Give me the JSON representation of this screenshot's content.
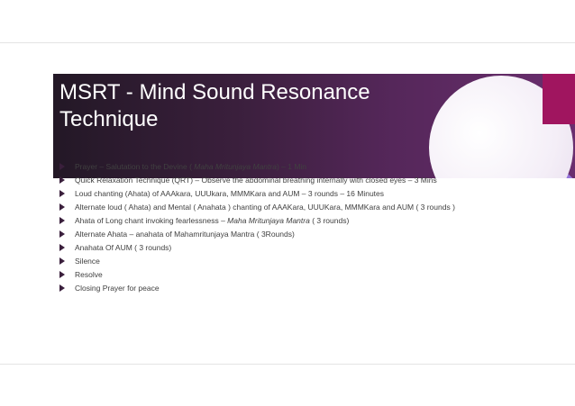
{
  "slide": {
    "title_line1": "MSRT - Mind Sound Resonance",
    "title_line2": "Technique",
    "colors": {
      "banner": "#3a1f3c",
      "accent_bar": "#a0155f",
      "circle_purple": "#8c6bd6",
      "text": "#404040",
      "bullet_arrow": "#3a1f3c"
    },
    "bullets": [
      {
        "text": "Prayer – Salutation to the Devine ( ",
        "italic": "Maha Mritunjaya Mantra",
        "after": ") – 1 Min"
      },
      {
        "text": "Quick Relaxation Technique (QRT) – Observe the abdominal breathing internally with closed eyes – 3 Mins",
        "italic": "",
        "after": ""
      },
      {
        "text": " Loud chanting (Ahata) of AAAkara, UUUkara, MMMKara and AUM – 3 rounds – 16 Minutes",
        "italic": "",
        "after": ""
      },
      {
        "text": "Alternate loud ( Ahata) and Mental ( Anahata ) chanting of AAAKara, UUUKara, MMMKara and AUM ( 3 rounds )",
        "italic": "",
        "after": ""
      },
      {
        "text": "Ahata of Long chant invoking fearlessness – ",
        "italic": "Maha Mritunjaya Mantra",
        "after": "  ( 3 rounds)"
      },
      {
        "text": " Alternate Ahata – anahata of Mahamritunjaya Mantra ( 3Rounds)",
        "italic": "",
        "after": ""
      },
      {
        "text": "Anahata Of AUM ( 3 rounds)",
        "italic": "",
        "after": ""
      },
      {
        "text": "Silence",
        "italic": "",
        "after": ""
      },
      {
        "text": "Resolve",
        "italic": "",
        "after": ""
      },
      {
        "text": "Closing Prayer for peace",
        "italic": "",
        "after": ""
      }
    ]
  }
}
